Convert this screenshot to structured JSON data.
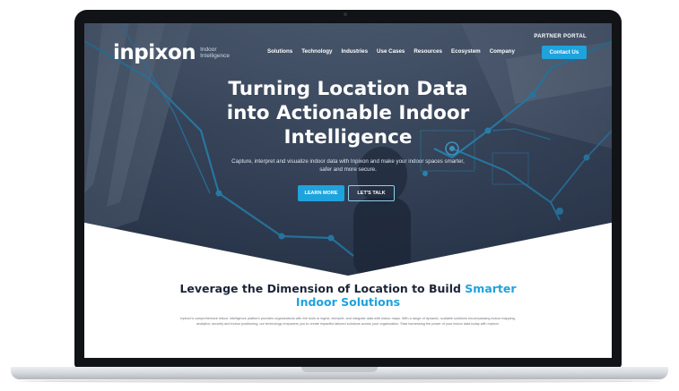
{
  "brand": {
    "name": "inpixon",
    "tagline": "Indoor Intelligence"
  },
  "header": {
    "partner_portal": "PARTNER PORTAL",
    "nav": [
      "Solutions",
      "Technology",
      "Industries",
      "Use Cases",
      "Resources",
      "Ecosystem",
      "Company"
    ],
    "contact_button": "Contact Us"
  },
  "hero": {
    "title_lines": [
      "Turning Location Data",
      "into Actionable Indoor",
      "Intelligence"
    ],
    "subtitle": "Capture, interpret and visualize indoor data with Inpixon and make your indoor spaces smarter, safer and more secure.",
    "primary_button": "LEARN MORE",
    "secondary_button": "LET'S TALK"
  },
  "section": {
    "title_plain": "Leverage the Dimension of Location to Build ",
    "title_highlight": "Smarter Indoor Solutions",
    "body": "Inpixon's comprehensive Indoor Intelligence platform provides organizations with the tools to ingest, interpret, and integrate data with indoor maps. With a range of dynamic, scalable solutions encompassing indoor mapping, analytics, security and indoor positioning, our technology empowers you to create impactful tailored solutions across your organization. Start harnessing the power of your indoor data today with Inpixon."
  },
  "colors": {
    "accent": "#1ea3dc",
    "heading": "#1c2438",
    "hero_dark": "#2f3c52",
    "bezel": "#111317"
  },
  "icons": {
    "camera": "camera-dot",
    "hero_graphic": "location-data-network-lines"
  }
}
